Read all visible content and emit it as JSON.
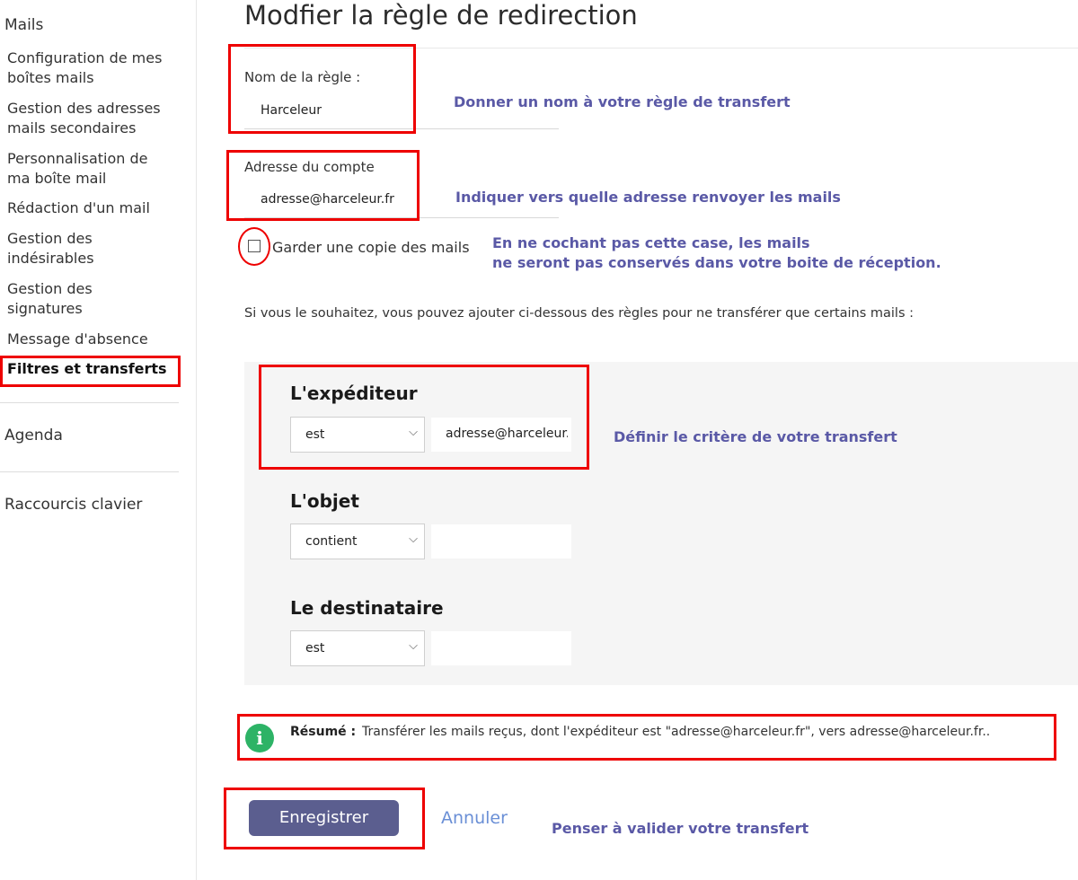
{
  "sidebar": {
    "header": "Mails",
    "items": [
      {
        "label_1": "Configuration de mes",
        "label_2": "boîtes mails"
      },
      {
        "label_1": "Gestion des adresses",
        "label_2": "mails secondaires"
      },
      {
        "label_1": "Personnalisation de",
        "label_2": "ma boîte mail"
      },
      {
        "label_1": "Rédaction d'un mail",
        "label_2": ""
      },
      {
        "label_1": "Gestion des",
        "label_2": "indésirables"
      },
      {
        "label_1": "Gestion des",
        "label_2": "signatures"
      },
      {
        "label_1": "Message d'absence",
        "label_2": ""
      },
      {
        "label_1": "Filtres et transferts",
        "label_2": ""
      }
    ],
    "agenda": "Agenda",
    "shortcuts": "Raccourcis clavier"
  },
  "page": {
    "title": "Modfier la règle de redirection"
  },
  "form": {
    "rule_name_label": "Nom de la règle :",
    "rule_name_value": "Harceleur",
    "account_label": "Adresse du compte",
    "account_value": "adresse@harceleur.fr",
    "keep_copy_label": "Garder une copie des mails",
    "info": "Si vous le souhaitez, vous pouvez ajouter ci-dessous des règles pour ne transférer que certains mails :"
  },
  "criteria": {
    "sender": {
      "title": "L'expéditeur",
      "operator": "est",
      "value": "adresse@harceleur.fr"
    },
    "subject": {
      "title": "L'objet",
      "operator": "contient",
      "value": ""
    },
    "recipient": {
      "title": "Le destinataire",
      "operator": "est",
      "value": ""
    }
  },
  "summary": {
    "icon": "i",
    "label": "Résumé :",
    "text": "Transférer les mails reçus, dont l'expéditeur est \"adresse@harceleur.fr\", vers adresse@harceleur.fr.."
  },
  "buttons": {
    "save": "Enregistrer",
    "cancel": "Annuler"
  },
  "annotations": {
    "name": "Donner un nom à votre règle de transfert",
    "address": "Indiquer vers quelle adresse renvoyer les mails",
    "copy_1": "En ne cochant pas cette case, les mails",
    "copy_2": "ne seront pas conservés dans votre boite de réception.",
    "criteria": "Définir le critère de votre transfert",
    "validate": "Penser à valider votre transfert"
  },
  "colors": {
    "annotation": "#5a59a6",
    "highlight": "#e00000",
    "button": "#5b5e8f",
    "info_icon": "#2db366",
    "link": "#6a8fd6"
  }
}
